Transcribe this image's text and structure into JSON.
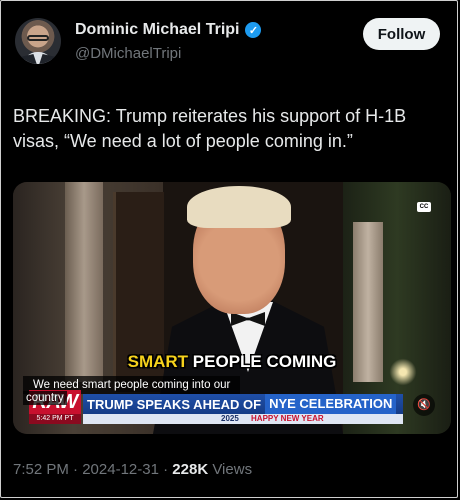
{
  "author": {
    "name": "Dominic Michael Tripi",
    "handle": "@DMichaelTripi",
    "verified_icon": "verified-badge-icon",
    "follow_label": "Follow"
  },
  "tweet": {
    "text": "BREAKING: Trump reiterates his support of H-1B visas, “We need a lot of people coming in.”"
  },
  "video": {
    "cc_label": "CC",
    "caption_highlight": "SMART",
    "caption_rest": " PEOPLE COMING",
    "subtitle_line1": "We need smart people coming into our",
    "subtitle_line2": "country",
    "network_logo": "RAW",
    "time_tag": "5:42 PM PT",
    "headline_part1": "TRUMP SPEAKS AHEAD OF",
    "headline_part2": "NYE CELEBRATION",
    "ticker_year": "2025",
    "ticker_text": "HAPPY NEW YEAR",
    "mute_icon": "speaker-muted-icon",
    "mute_glyph": "🔇"
  },
  "meta": {
    "time": "7:52 PM",
    "sep1": " · ",
    "date": "2024-12-31",
    "sep2": " · ",
    "views_count": "228K",
    "views_label": " Views"
  }
}
